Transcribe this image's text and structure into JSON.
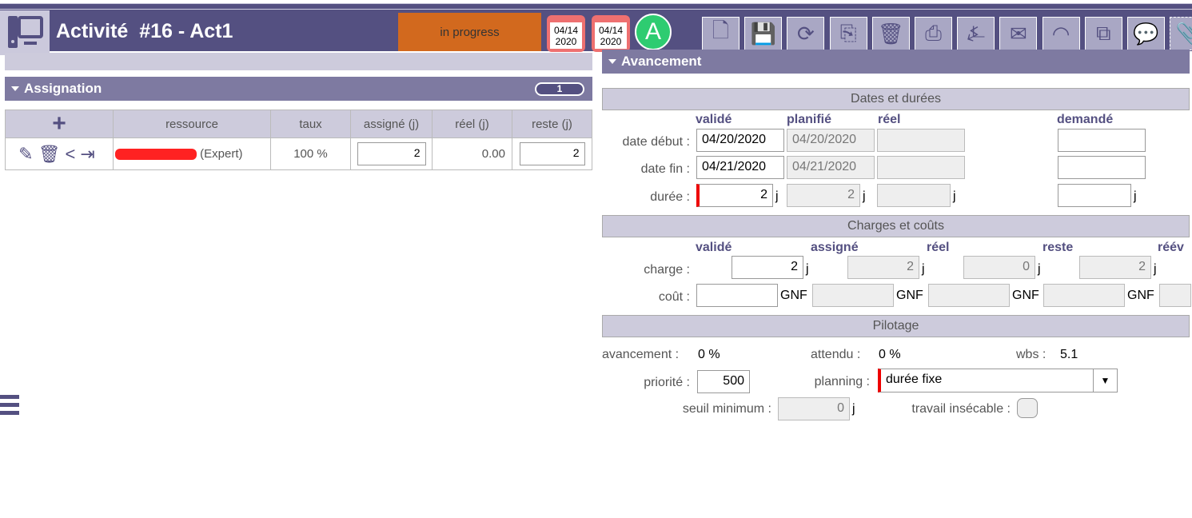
{
  "header": {
    "title": "Activité  #16 - Act1",
    "status": "in progress",
    "status_color": "#d2691e",
    "cal1": [
      "04/14",
      "2020"
    ],
    "cal2": [
      "04/14",
      "2020"
    ],
    "avatar": "A",
    "toolbar": [
      "new-document",
      "save",
      "refresh",
      "copy",
      "delete",
      "print",
      "pdf",
      "email",
      "rss",
      "multi-save",
      "comment",
      "attach"
    ]
  },
  "assignation": {
    "title": "Assignation",
    "count": "1",
    "columns": [
      "+",
      "ressource",
      "taux",
      "assigné (j)",
      "réel (j)",
      "reste (j)"
    ],
    "rows": [
      {
        "role": "(Expert)",
        "taux": "100 %",
        "assigne": "2",
        "reel": "0.00",
        "reste": "2"
      }
    ]
  },
  "avancement": {
    "title": "Avancement",
    "dates": {
      "title": "Dates et durées",
      "cols": [
        "validé",
        "planifié",
        "réel",
        "demandé"
      ],
      "debut_label": "date début :",
      "fin_label": "date fin :",
      "duree_label": "durée :",
      "debut": [
        "04/20/2020",
        "04/20/2020",
        "",
        ""
      ],
      "fin": [
        "04/21/2020",
        "04/21/2020",
        "",
        ""
      ],
      "duree": [
        "2",
        "2",
        "",
        ""
      ],
      "unit": "j"
    },
    "charges": {
      "title": "Charges et coûts",
      "cols": [
        "validé",
        "assigné",
        "réel",
        "reste",
        "réév"
      ],
      "charge_label": "charge :",
      "cout_label": "coût :",
      "charge": [
        "2",
        "2",
        "0",
        "2"
      ],
      "unit": "j",
      "currency": "GNF"
    },
    "pilotage": {
      "title": "Pilotage",
      "avancement_label": "avancement :",
      "avancement": "0 %",
      "attendu_label": "attendu :",
      "attendu": "0 %",
      "wbs_label": "wbs :",
      "wbs": "5.1",
      "priorite_label": "priorité :",
      "priorite": "500",
      "planning_label": "planning :",
      "planning": "durée fixe",
      "seuil_label": "seuil minimum :",
      "seuil": "0",
      "seuil_unit": "j",
      "insecable_label": "travail insécable :"
    }
  }
}
